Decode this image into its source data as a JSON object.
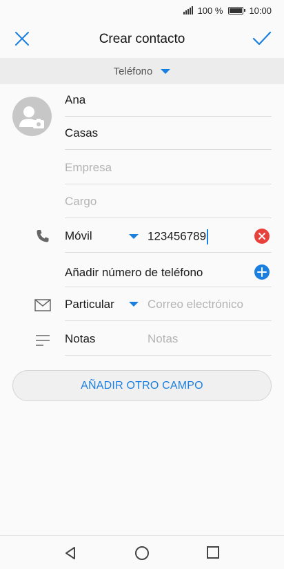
{
  "status_bar": {
    "battery_percent": "100 %",
    "time": "10:00"
  },
  "header": {
    "title": "Crear contacto"
  },
  "storage": {
    "label": "Teléfono"
  },
  "form": {
    "first_name": "Ana",
    "last_name": "Casas",
    "company_placeholder": "Empresa",
    "title_placeholder": "Cargo",
    "phone_type": "Móvil",
    "phone_value": "123456789",
    "add_phone_label": "Añadir número de teléfono",
    "email_type": "Particular",
    "email_placeholder": "Correo electrónico",
    "notes_label": "Notas",
    "notes_placeholder": "Notas"
  },
  "add_field_button": "AÑADIR OTRO CAMPO",
  "colors": {
    "accent": "#1b7fe0",
    "danger": "#e8413b",
    "avatar_bg": "#c7c7c7"
  },
  "icons": [
    "close-icon",
    "check-icon",
    "camera-icon",
    "phone-icon",
    "mail-icon",
    "notes-icon",
    "clear-icon",
    "add-icon",
    "back-icon",
    "home-icon",
    "recents-icon"
  ]
}
